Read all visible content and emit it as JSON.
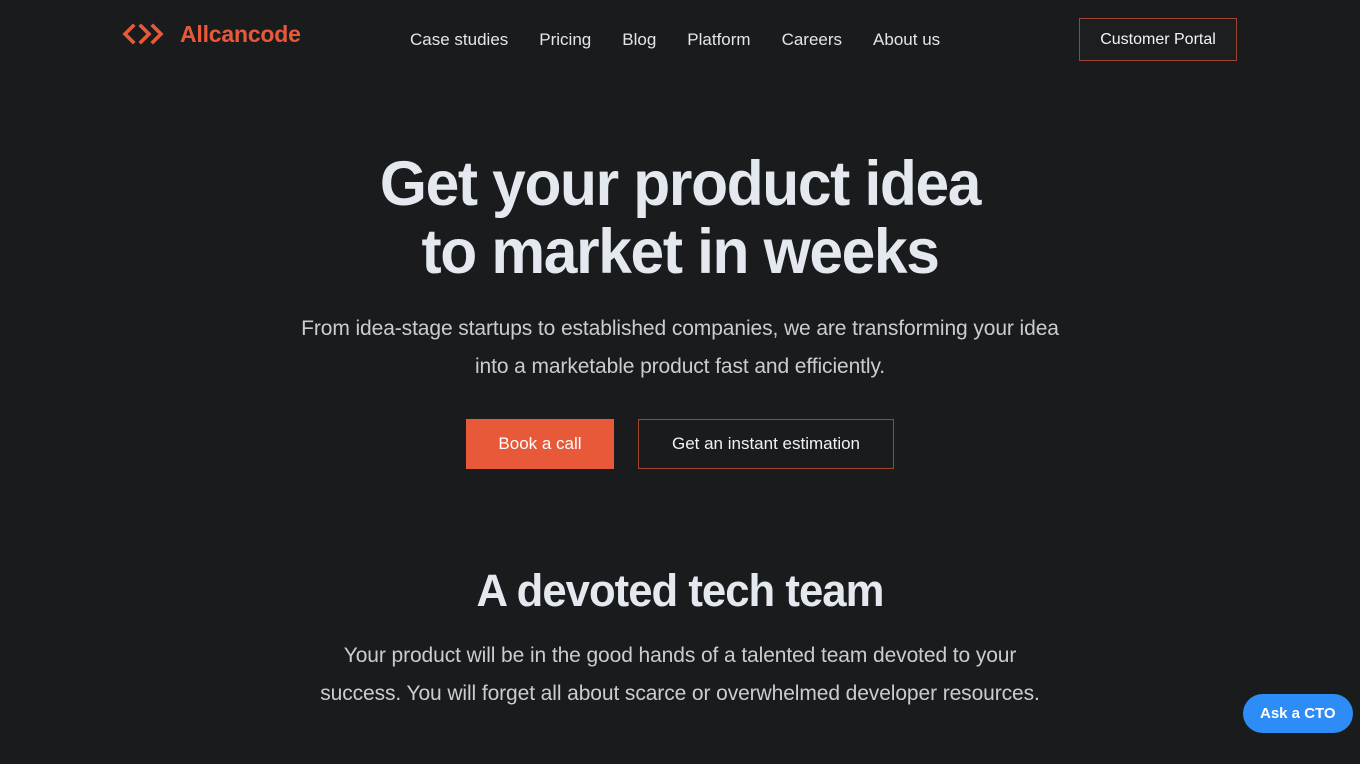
{
  "colors": {
    "background": "#1a1b1d",
    "accent_orange": "#e8593a",
    "accent_border": "#a2452f",
    "text_primary": "#e4e9ef",
    "text_secondary": "#c9ccd1",
    "chat_blue": "#2d8cf5"
  },
  "header": {
    "logo": {
      "icon": "code-chevrons-icon",
      "text": "Allcancode"
    },
    "nav": [
      {
        "label": "Case studies"
      },
      {
        "label": "Pricing"
      },
      {
        "label": "Blog"
      },
      {
        "label": "Platform"
      },
      {
        "label": "Careers"
      },
      {
        "label": "About us"
      }
    ],
    "portal_button": "Customer Portal"
  },
  "hero": {
    "title": "Get your product idea to market in weeks",
    "subtitle": "From idea-stage startups to established companies, we are transforming your idea into a marketable product fast and efficiently.",
    "primary_cta": "Book a call",
    "secondary_cta": "Get an instant estimation"
  },
  "team_section": {
    "title": "A devoted tech team",
    "subtitle": "Your product will be in the good hands of a talented team devoted to your success. You will forget all about scarce or overwhelmed developer resources."
  },
  "chat_widget": {
    "label": "Ask a CTO"
  }
}
